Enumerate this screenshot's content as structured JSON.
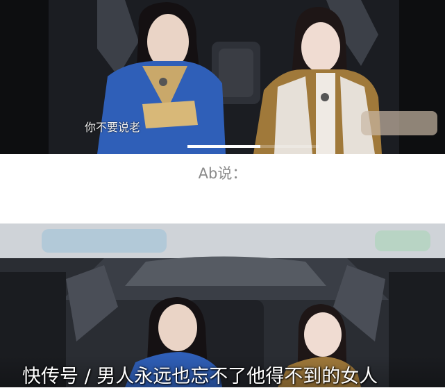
{
  "top_clip": {
    "subtitle": "你不要说老",
    "playback_progress": 0.55
  },
  "middle": {
    "speaker_label": "Ab说："
  },
  "bottom_clip": {
    "caption": "快传号 / 男人永远也忘不了他得不到的女人"
  },
  "colors": {
    "car_interior_dark": "#1b1d22",
    "blue_outfit": "#2f5fb8",
    "gold_dots": "#a0793a"
  }
}
